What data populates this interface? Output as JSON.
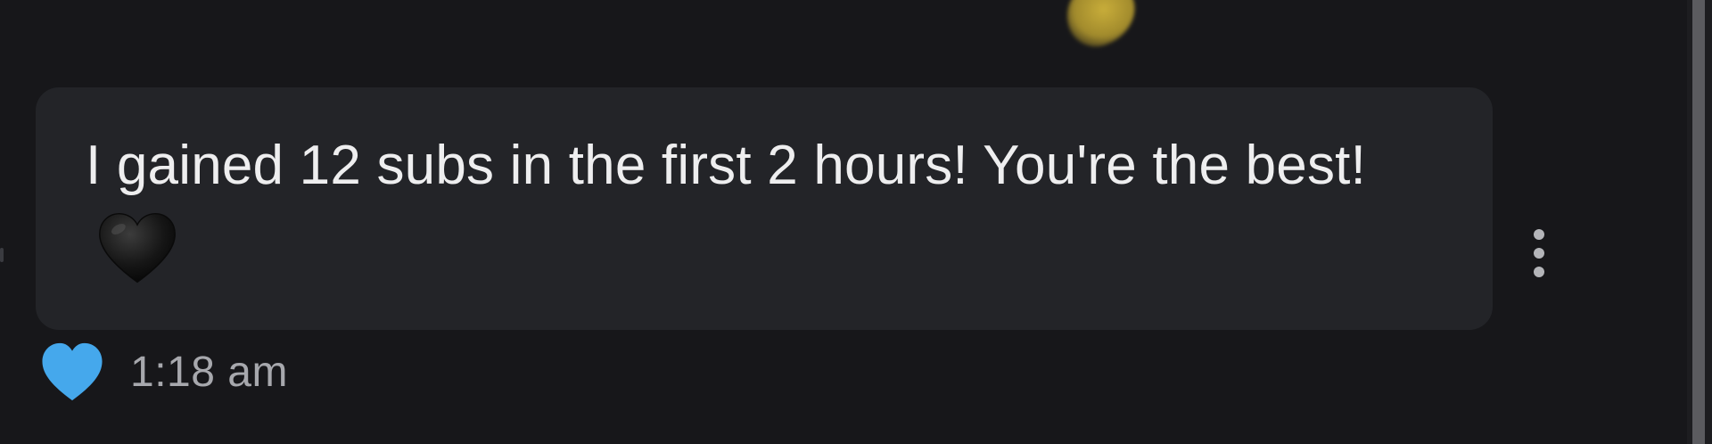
{
  "message": {
    "text": "I gained 12 subs in the first 2 hours! You're the best!",
    "inline_emoji": "black-heart-icon",
    "timestamp": "1:18 am",
    "reaction_icon": "blue-heart-icon",
    "menu_icon": "more-vertical-icon"
  },
  "colors": {
    "background": "#17171a",
    "bubble": "#232428",
    "message_text": "#eeeeef",
    "timestamp_text": "#a7a8ad",
    "reaction_heart": "#45a8ec",
    "menu_dots": "#b4b5b9",
    "scrollbar_thumb": "#5b5b5f"
  }
}
